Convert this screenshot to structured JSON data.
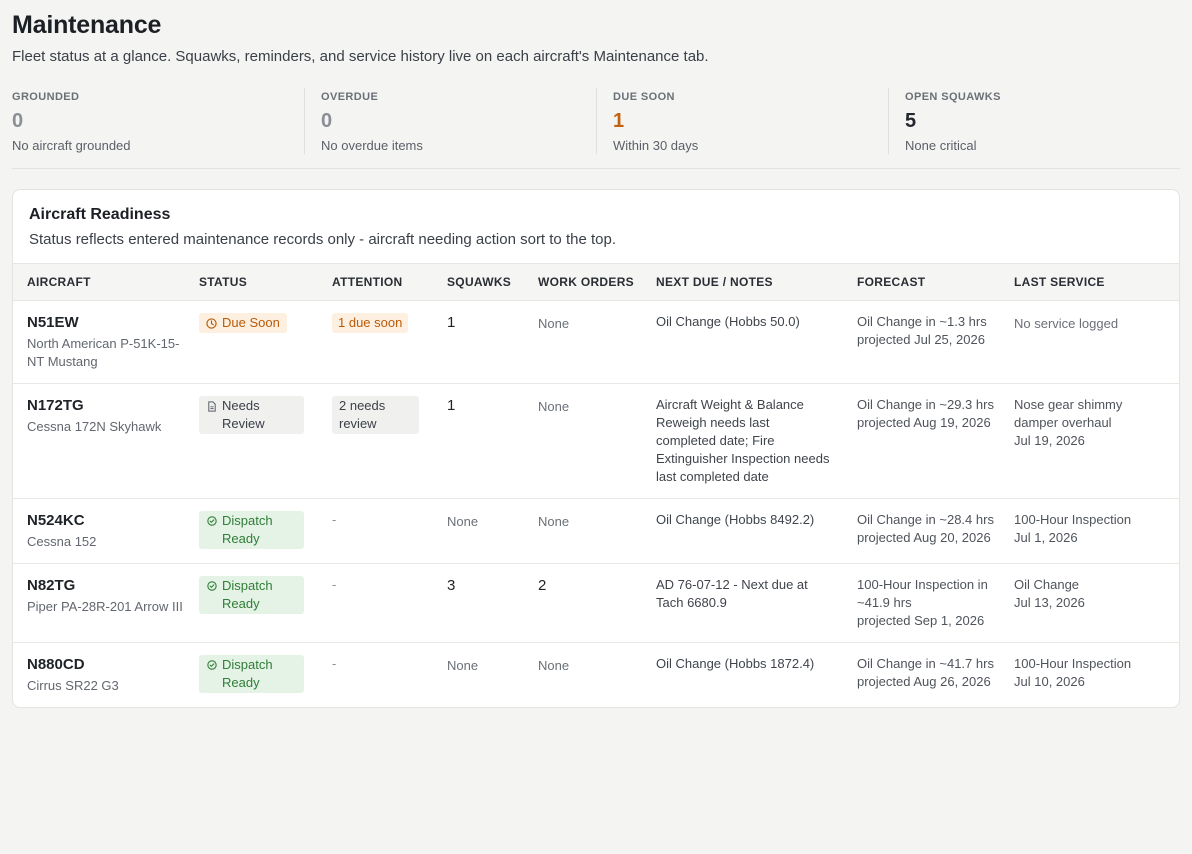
{
  "header": {
    "title": "Maintenance",
    "subtitle": "Fleet status at a glance. Squawks, reminders, and service history live on each aircraft's Maintenance tab."
  },
  "stats": [
    {
      "label": "GROUNDED",
      "value": "0",
      "caption": "No aircraft grounded"
    },
    {
      "label": "OVERDUE",
      "value": "0",
      "caption": "No overdue items"
    },
    {
      "label": "DUE SOON",
      "value": "1",
      "caption": "Within 30 days"
    },
    {
      "label": "OPEN SQUAWKS",
      "value": "5",
      "caption": "None critical"
    }
  ],
  "readiness": {
    "title": "Aircraft Readiness",
    "subtitle": "Status reflects entered maintenance records only - aircraft needing action sort to the top.",
    "columns": [
      "AIRCRAFT",
      "STATUS",
      "ATTENTION",
      "SQUAWKS",
      "WORK ORDERS",
      "NEXT DUE / NOTES",
      "FORECAST",
      "LAST SERVICE"
    ],
    "rows": [
      {
        "reg": "N51EW",
        "model": "North American P-51K-15-NT Mustang",
        "status": "Due Soon",
        "status_icon": "clock-icon",
        "attention": "1 due soon",
        "squawks": "1",
        "work_orders": "None",
        "next_due": "Oil Change (Hobbs 50.0)",
        "forecast": "Oil Change in ~1.3 hrs",
        "forecast_date": "projected Jul 25, 2026",
        "last_service": "No service logged",
        "last_service_date": ""
      },
      {
        "reg": "N172TG",
        "model": "Cessna 172N Skyhawk",
        "status": "Needs Review",
        "status_icon": "document-icon",
        "attention": "2 needs review",
        "squawks": "1",
        "work_orders": "None",
        "next_due": "Aircraft Weight & Balance Reweigh needs last completed date; Fire Extinguisher Inspection needs last completed date",
        "forecast": "Oil Change in ~29.3 hrs",
        "forecast_date": "projected Aug 19, 2026",
        "last_service": "Nose gear shimmy damper overhaul",
        "last_service_date": "Jul 19, 2026"
      },
      {
        "reg": "N524KC",
        "model": "Cessna 152",
        "status": "Dispatch Ready",
        "status_icon": "check-circle-icon",
        "attention": "-",
        "squawks": "None",
        "work_orders": "None",
        "next_due": "Oil Change (Hobbs 8492.2)",
        "forecast": "Oil Change in ~28.4 hrs",
        "forecast_date": "projected Aug 20, 2026",
        "last_service": "100-Hour Inspection",
        "last_service_date": "Jul 1, 2026"
      },
      {
        "reg": "N82TG",
        "model": "Piper PA-28R-201 Arrow III",
        "status": "Dispatch Ready",
        "status_icon": "check-circle-icon",
        "attention": "-",
        "squawks": "3",
        "work_orders": "2",
        "next_due": "AD 76-07-12 - Next due at Tach 6680.9",
        "forecast": "100-Hour Inspection in ~41.9 hrs",
        "forecast_date": "projected Sep 1, 2026",
        "last_service": "Oil Change",
        "last_service_date": "Jul 13, 2026"
      },
      {
        "reg": "N880CD",
        "model": "Cirrus SR22 G3",
        "status": "Dispatch Ready",
        "status_icon": "check-circle-icon",
        "attention": "-",
        "squawks": "None",
        "work_orders": "None",
        "next_due": "Oil Change (Hobbs 1872.4)",
        "forecast": "Oil Change in ~41.7 hrs",
        "forecast_date": "projected Aug 26, 2026",
        "last_service": "100-Hour Inspection",
        "last_service_date": "Jul 10, 2026"
      }
    ]
  },
  "colors": {
    "due_soon": "#b85b0a",
    "dispatch_ready": "#2f7d37",
    "needs_review": "#3c4148"
  }
}
